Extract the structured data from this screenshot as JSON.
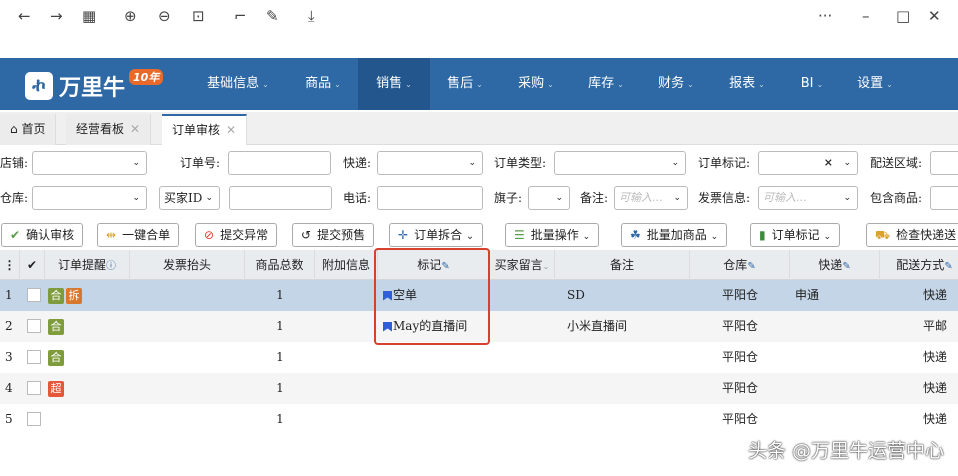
{
  "browser_toolbar": {
    "icons": [
      "back-icon",
      "forward-icon",
      "grid-icon",
      "zoom-in-icon",
      "zoom-out-icon",
      "fit-icon",
      "crop-icon",
      "edit-icon",
      "download-icon",
      "more-icon",
      "minimize-icon",
      "maximize-icon",
      "close-icon"
    ]
  },
  "app": {
    "logo_text": "万里牛",
    "logo_badge": "10年"
  },
  "nav": [
    "基础信息",
    "商品",
    "销售",
    "售后",
    "采购",
    "库存",
    "财务",
    "报表",
    "BI",
    "设置"
  ],
  "tabs": [
    {
      "label": "首页"
    },
    {
      "label": "经营看板"
    },
    {
      "label": "订单审核"
    }
  ],
  "filters": {
    "shop": "店铺:",
    "order_no": "订单号:",
    "express": "快递:",
    "order_type": "订单类型:",
    "order_mark": "订单标记:",
    "order_mark_clear": "×",
    "region": "配送区域:",
    "warehouse": "仓库:",
    "buyer_id": "买家ID",
    "phone": "电话:",
    "flag": "旗子:",
    "remark": "备注:",
    "remark_ph": "可输入...",
    "invoice": "发票信息:",
    "invoice_ph": "可输入...",
    "contains": "包含商品:"
  },
  "actions": [
    "确认审核",
    "一键合单",
    "提交异常",
    "提交预售",
    "订单拆合",
    "批量操作",
    "批量加商品",
    "订单标记",
    "检查快递送"
  ],
  "columns": [
    "订单提醒",
    "发票抬头",
    "商品总数",
    "附加信息",
    "标记",
    "买家留言",
    "备注",
    "仓库",
    "快递",
    "配送方式"
  ],
  "rows": [
    {
      "idx": "1",
      "badges": [
        {
          "t": "合",
          "c": "#7f9c3c"
        },
        {
          "t": "拆",
          "c": "#d9772f"
        }
      ],
      "qty": "1",
      "mark": "空单",
      "remark": "SD",
      "warehouse": "平阳仓",
      "express": "申通",
      "ship": "快递"
    },
    {
      "idx": "2",
      "badges": [
        {
          "t": "合",
          "c": "#7f9c3c"
        }
      ],
      "qty": "1",
      "mark": "May的直播间",
      "remark": "小米直播间",
      "warehouse": "平阳仓",
      "express": "",
      "ship": "平邮"
    },
    {
      "idx": "3",
      "badges": [
        {
          "t": "合",
          "c": "#7f9c3c"
        }
      ],
      "qty": "1",
      "mark": "",
      "remark": "",
      "warehouse": "平阳仓",
      "express": "",
      "ship": "快递"
    },
    {
      "idx": "4",
      "badges": [
        {
          "t": "超",
          "c": "#e4573a"
        }
      ],
      "qty": "1",
      "mark": "",
      "remark": "",
      "warehouse": "平阳仓",
      "express": "",
      "ship": "快递"
    },
    {
      "idx": "5",
      "badges": [],
      "qty": "1",
      "mark": "",
      "remark": "",
      "warehouse": "平阳仓",
      "express": "",
      "ship": "快递"
    }
  ],
  "watermark": "头条 @万里牛运营中心"
}
